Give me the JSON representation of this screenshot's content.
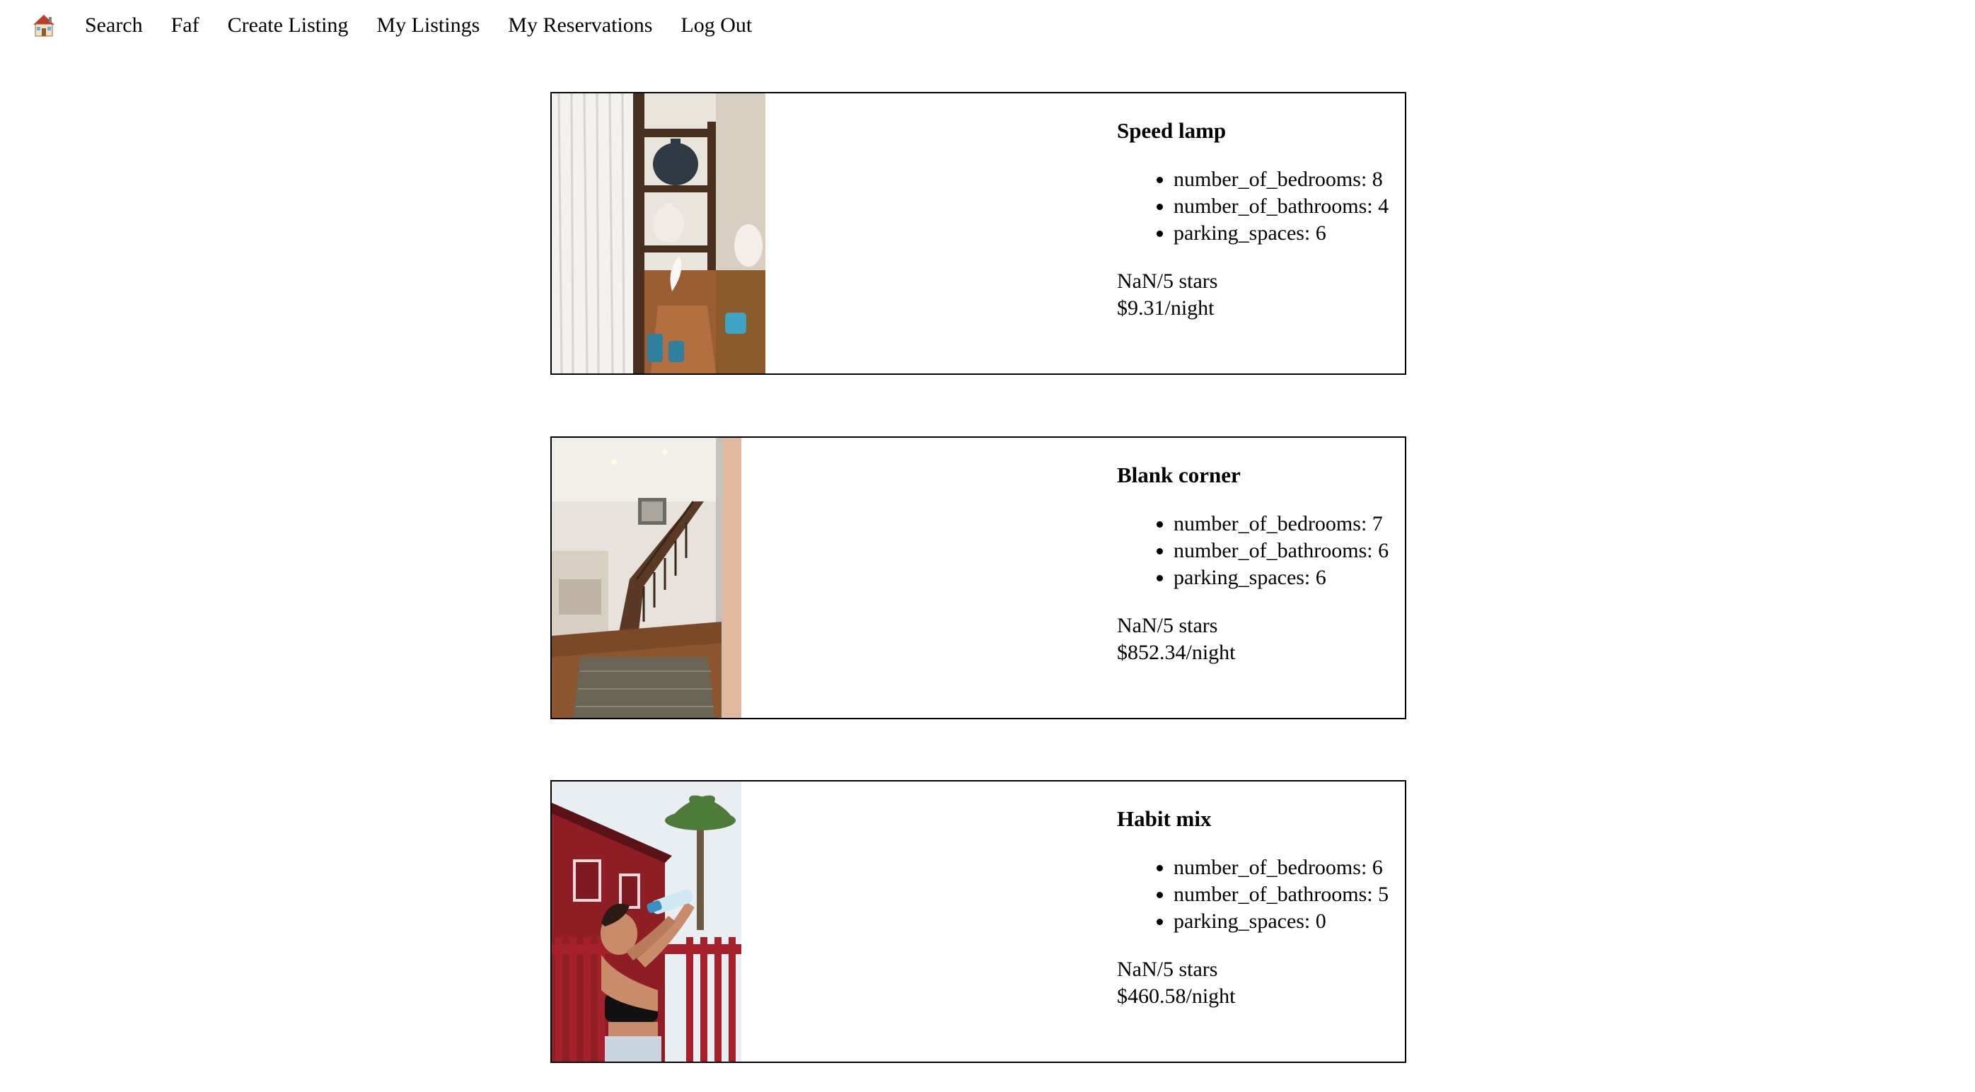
{
  "nav": {
    "home_icon": "house-emoji-icon",
    "items": [
      {
        "label": "Search"
      },
      {
        "label": "Faf"
      },
      {
        "label": "Create Listing"
      },
      {
        "label": "My Listings"
      },
      {
        "label": "My Reservations"
      },
      {
        "label": "Log Out"
      }
    ]
  },
  "listings": [
    {
      "title": "Speed lamp",
      "features": [
        "number_of_bedrooms: 8",
        "number_of_bathrooms: 4",
        "parking_spaces: 6"
      ],
      "rating": "NaN/5 stars",
      "price": "$9.31/night",
      "image": "living-room-shelves-photo"
    },
    {
      "title": "Blank corner",
      "features": [
        "number_of_bedrooms: 7",
        "number_of_bathrooms: 6",
        "parking_spaces: 6"
      ],
      "rating": "NaN/5 stars",
      "price": "$852.34/night",
      "image": "entryway-staircase-photo"
    },
    {
      "title": "Habit mix",
      "features": [
        "number_of_bedrooms: 6",
        "number_of_bathrooms: 5",
        "parking_spaces: 0"
      ],
      "rating": "NaN/5 stars",
      "price": "$460.58/night",
      "image": "woman-drinking-water-red-house-photo"
    }
  ]
}
